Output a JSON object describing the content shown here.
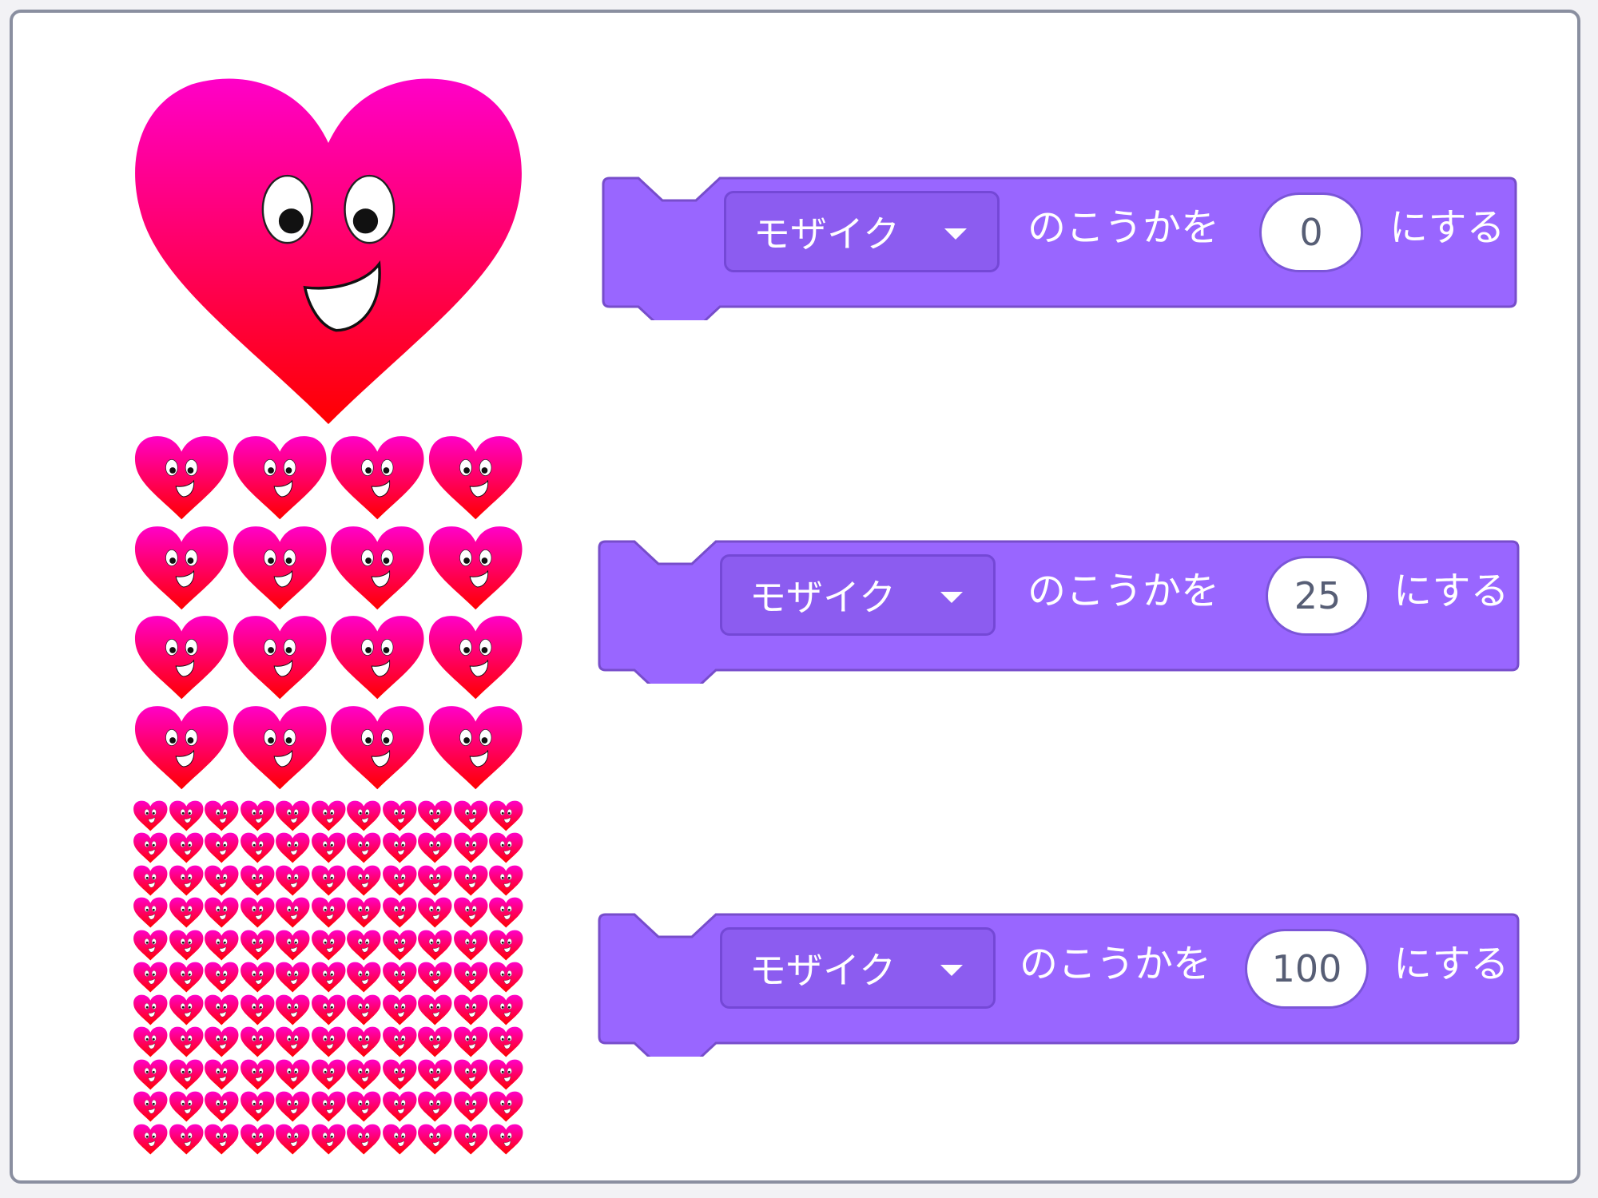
{
  "sprite": {
    "name": "heart",
    "gradient_top": "#ff00c8",
    "gradient_bottom": "#ff0000",
    "mosaic_levels": [
      {
        "grid": 1
      },
      {
        "grid": 4
      },
      {
        "grid": 11
      }
    ]
  },
  "blocks": [
    {
      "effect": "モザイク",
      "middle_text": "のこうかを",
      "value": "0",
      "suffix": "にする"
    },
    {
      "effect": "モザイク",
      "middle_text": "のこうかを",
      "value": "25",
      "suffix": "にする"
    },
    {
      "effect": "モザイク",
      "middle_text": "のこうかを",
      "value": "100",
      "suffix": "にする"
    }
  ],
  "colors": {
    "block_fill": "#9966ff",
    "block_stroke": "#774dcb",
    "dropdown_fill": "#8c5cf0",
    "frame_border": "#8a8fa0",
    "input_text": "#575e75"
  },
  "icons": [
    "heart-sprite-icon",
    "dropdown-caret-icon"
  ]
}
